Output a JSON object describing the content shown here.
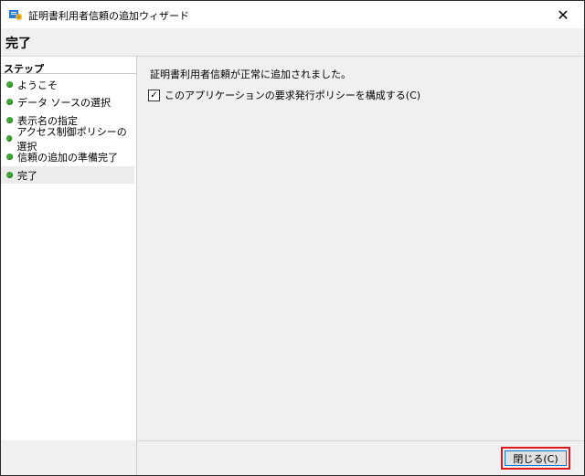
{
  "window": {
    "title": "証明書利用者信頼の追加ウィザード",
    "close_glyph": "✕"
  },
  "header": {
    "title": "完了"
  },
  "sidebar": {
    "steps_label": "ステップ",
    "items": [
      {
        "label": "ようこそ"
      },
      {
        "label": "データ ソースの選択"
      },
      {
        "label": "表示名の指定"
      },
      {
        "label": "アクセス制御ポリシーの選択"
      },
      {
        "label": "信頼の追加の準備完了"
      },
      {
        "label": "完了",
        "active": true
      }
    ],
    "status_color": "#3aaa35"
  },
  "main": {
    "message": "証明書利用者信頼が正常に追加されました。",
    "checkbox": {
      "label": "このアプリケーションの要求発行ポリシーを構成する(C)",
      "checked": true,
      "check_glyph": "✓"
    }
  },
  "footer": {
    "close_button_label": "閉じる(C)",
    "highlight_color": "#e0181e"
  }
}
